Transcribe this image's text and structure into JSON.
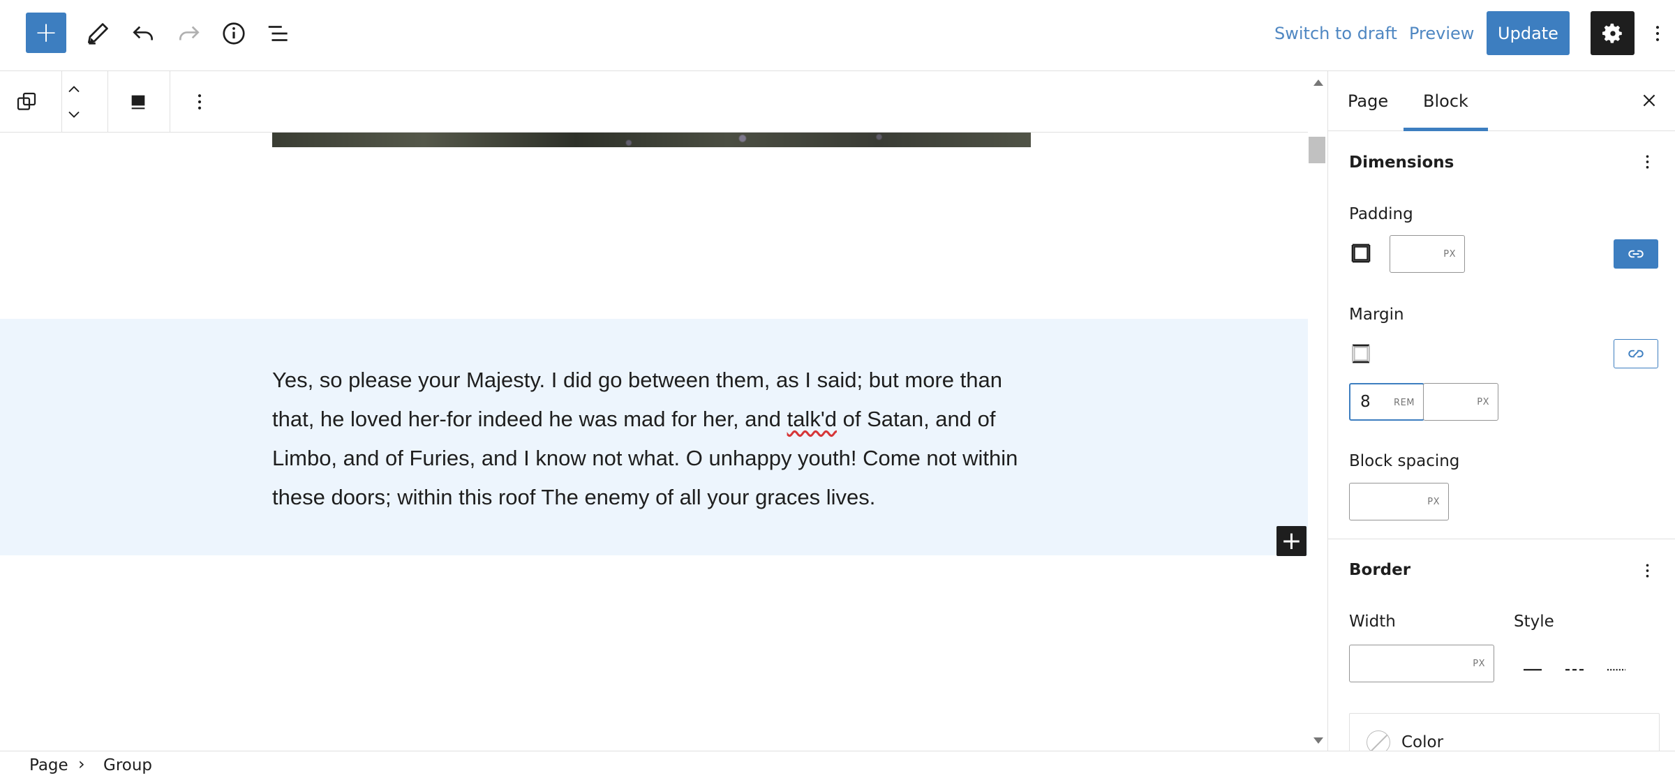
{
  "header": {
    "inserter_label": "+",
    "switch_to_draft": "Switch to draft",
    "preview": "Preview",
    "update": "Update"
  },
  "canvas": {
    "paragraph_parts": [
      "Yes, so please your Majesty. I did go between them, as I said; but more than that, he loved her-for indeed he was mad for her, and ",
      "talk'd",
      " of Satan, and of Limbo, and of Furies, and I know not what. O unhappy youth! Come not within these doors; within this roof The enemy of all your graces lives."
    ]
  },
  "sidebar": {
    "tabs": [
      "Page",
      "Block"
    ],
    "active_tab": "Block",
    "dimensions": {
      "title": "Dimensions",
      "padding_label": "Padding",
      "padding_value": "",
      "padding_unit": "PX",
      "margin_label": "Margin",
      "margin_top_value": "8",
      "margin_top_unit": "REM",
      "margin_bottom_value": "",
      "margin_bottom_unit": "PX",
      "block_spacing_label": "Block spacing",
      "block_spacing_value": "",
      "block_spacing_unit": "PX"
    },
    "border": {
      "title": "Border",
      "width_label": "Width",
      "width_value": "",
      "width_unit": "PX",
      "style_label": "Style",
      "color_label": "Color"
    }
  },
  "breadcrumb": [
    "Page",
    "Group"
  ],
  "colors": {
    "accent": "#3d7ec0",
    "group_background": "#edf5fd",
    "dark": "#1e1e1e"
  }
}
